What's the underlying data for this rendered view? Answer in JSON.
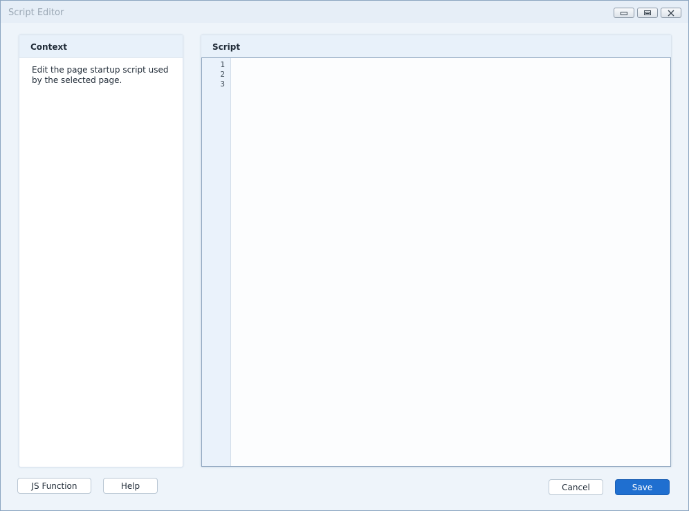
{
  "window": {
    "title": "Script Editor",
    "controls": {
      "minimize": "minimize-icon",
      "maximize": "maximize-icon",
      "close": "close-icon"
    }
  },
  "context_panel": {
    "header": "Context",
    "description": "Edit the page startup script used by the selected page."
  },
  "script_panel": {
    "header": "Script",
    "line_numbers": [
      "1",
      "2",
      "3"
    ],
    "code": ""
  },
  "footer": {
    "js_function_label": "JS Function",
    "help_label": "Help",
    "cancel_label": "Cancel",
    "save_label": "Save"
  },
  "colors": {
    "accent": "#1f6fd0",
    "header_bg": "#e8f1fa",
    "window_bg": "#eef4fa"
  }
}
